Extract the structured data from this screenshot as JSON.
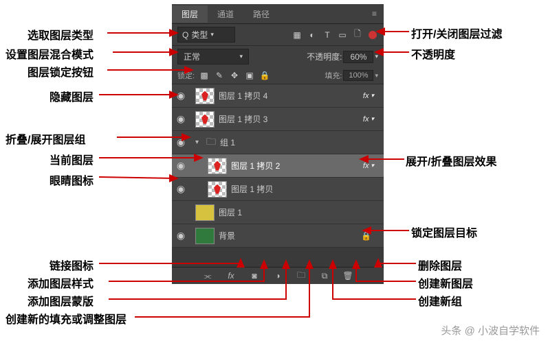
{
  "tabs": {
    "layers": "图层",
    "channels": "通道",
    "paths": "路径"
  },
  "filter": {
    "prefix": "Q",
    "label": "类型"
  },
  "blend": {
    "mode": "正常",
    "opacity_label": "不透明度:",
    "opacity_value": "60%"
  },
  "lock": {
    "label": "锁定:",
    "fill_label": "填充:",
    "fill_value": "100%"
  },
  "layers_list": [
    {
      "name": "图层 1 拷贝 4",
      "fx": true,
      "eye": true,
      "thumb": "sprite",
      "indent": 0
    },
    {
      "name": "图层 1 拷贝 3",
      "fx": true,
      "eye": true,
      "thumb": "sprite",
      "indent": 0
    },
    {
      "name": "组 1",
      "group": true,
      "eye": true,
      "indent": 0
    },
    {
      "name": "图层 1 拷贝 2",
      "fx": true,
      "eye": true,
      "thumb": "sprite",
      "indent": 1,
      "selected": true
    },
    {
      "name": "图层 1 拷贝",
      "eye": true,
      "thumb": "sprite",
      "indent": 1
    },
    {
      "name": "图层 1",
      "thumb": "yellow",
      "indent": 0
    },
    {
      "name": "背景",
      "eye": true,
      "thumb": "green",
      "lock": true,
      "indent": 0
    }
  ],
  "labels_left": {
    "l1": "选取图层类型",
    "l2": "设置图层混合模式",
    "l3": "图层锁定按钮",
    "l4": "隐藏图层",
    "l5": "折叠/展开图层组",
    "l6": "当前图层",
    "l7": "眼睛图标",
    "l8": "链接图标",
    "l9": "添加图层样式",
    "l10": "添加图层蒙版",
    "l11": "创建新的填充或调整图层"
  },
  "labels_right": {
    "r1": "打开/关闭图层过滤",
    "r2": "不透明度",
    "r3": "展开/折叠图层效果",
    "r4": "锁定图层目标",
    "r5": "删除图层",
    "r6": "创建新图层",
    "r7": "创建新组"
  },
  "watermark": "头条 @ 小波自学软件"
}
